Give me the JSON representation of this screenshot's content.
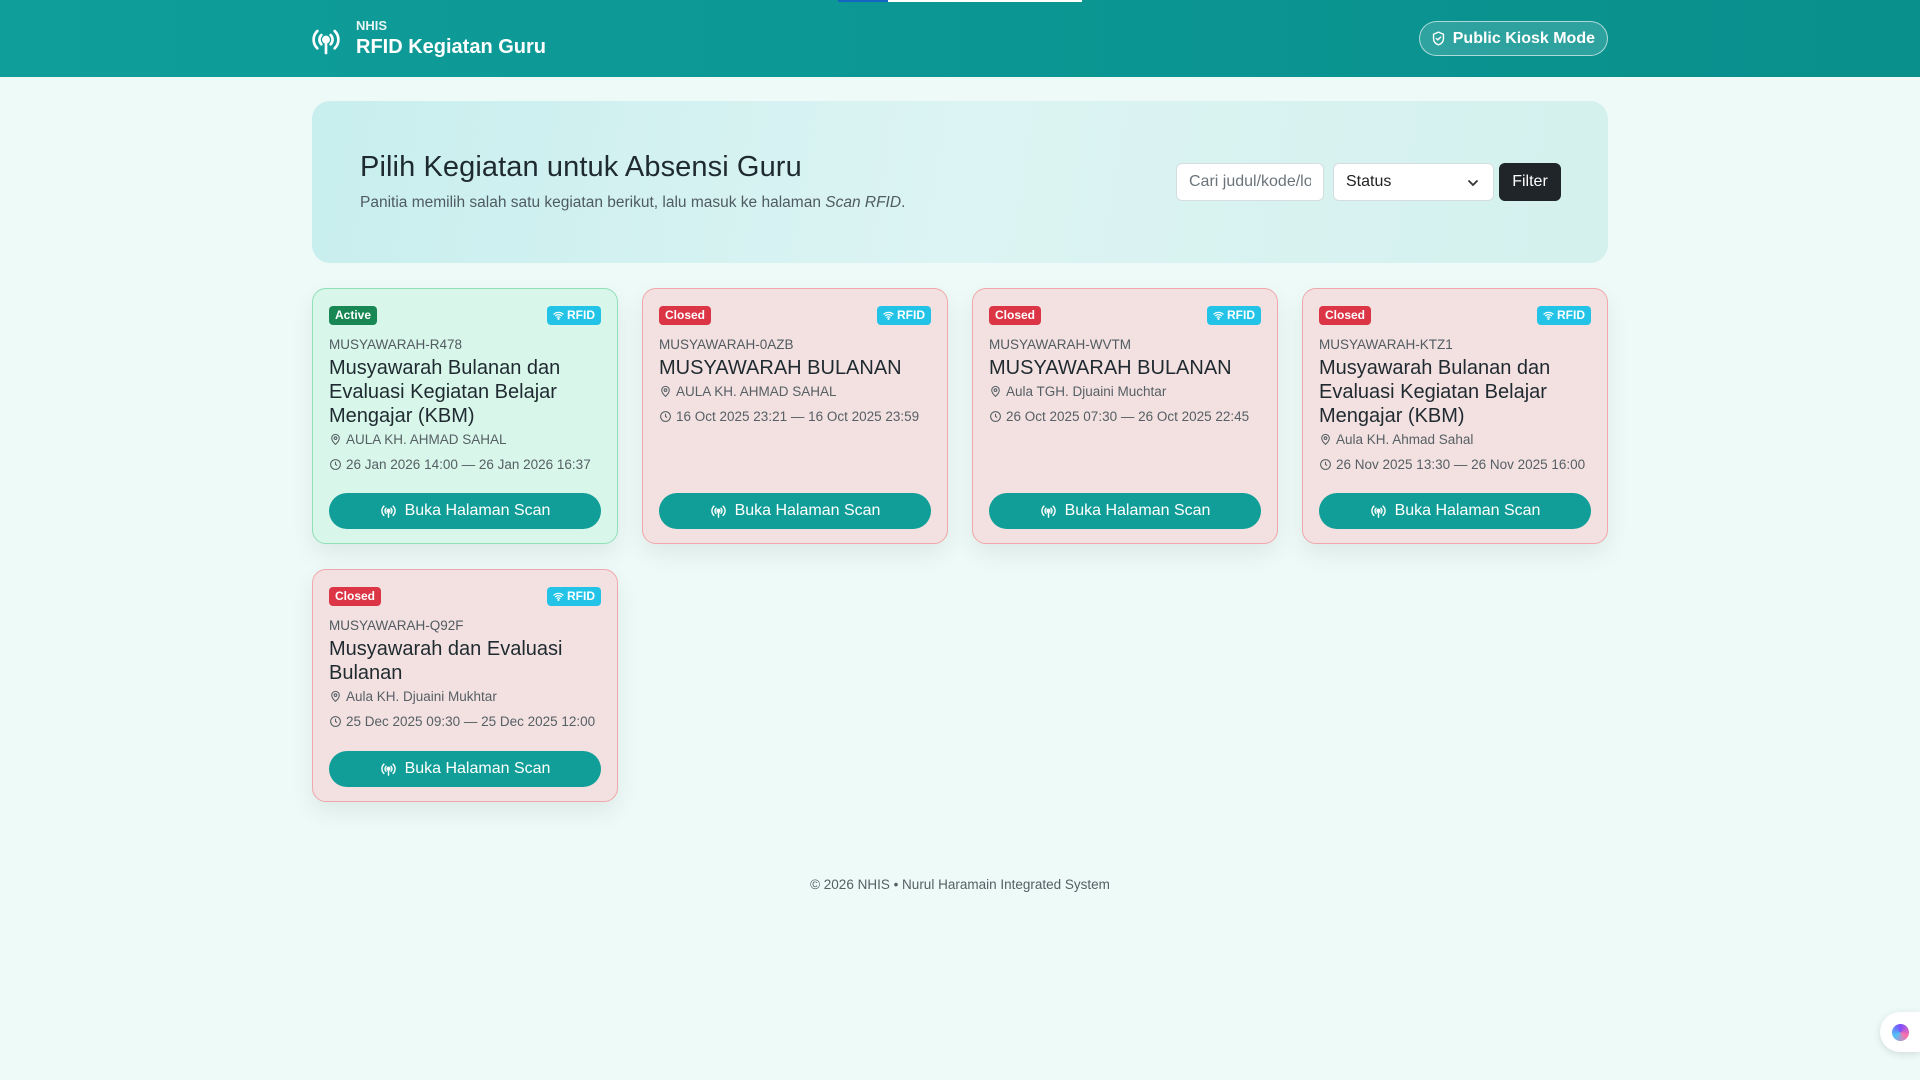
{
  "nav": {
    "brand_small": "NHIS",
    "brand_title": "RFID Kegiatan Guru",
    "kiosk_label": "Public Kiosk Mode"
  },
  "hero": {
    "title": "Pilih Kegiatan untuk Absensi Guru",
    "subtitle_prefix": "Panitia memilih salah satu kegiatan berikut, lalu masuk ke halaman ",
    "subtitle_em": "Scan RFID",
    "subtitle_suffix": ".",
    "search_placeholder": "Cari judul/kode/lokasi",
    "status_label": "Status",
    "filter_label": "Filter"
  },
  "rfid_label": "RFID",
  "scan_label": "Buka Halaman Scan",
  "events": [
    {
      "status": "Active",
      "code": "MUSYAWARAH-R478",
      "title": "Musyawarah Bulanan dan Evaluasi Kegiatan Belajar Mengajar (KBM)",
      "location": "AULA KH. AHMAD SAHAL",
      "time": "26 Jan 2026 14:00 — 26 Jan 2026 16:37"
    },
    {
      "status": "Closed",
      "code": "MUSYAWARAH-0AZB",
      "title": "MUSYAWARAH BULANAN",
      "location": "AULA KH. AHMAD SAHAL",
      "time": "16 Oct 2025 23:21 — 16 Oct 2025 23:59"
    },
    {
      "status": "Closed",
      "code": "MUSYAWARAH-WVTM",
      "title": "MUSYAWARAH BULANAN",
      "location": "Aula TGH. Djuaini Muchtar",
      "time": "26 Oct 2025 07:30 — 26 Oct 2025 22:45"
    },
    {
      "status": "Closed",
      "code": "MUSYAWARAH-KTZ1",
      "title": "Musyawarah Bulanan dan Evaluasi Kegiatan Belajar Mengajar (KBM)",
      "location": "Aula KH. Ahmad Sahal",
      "time": "26 Nov 2025 13:30 — 26 Nov 2025 16:00"
    },
    {
      "status": "Closed",
      "code": "MUSYAWARAH-Q92F",
      "title": "Musyawarah dan Evaluasi Bulanan",
      "location": "Aula KH. Djuaini Mukhtar",
      "time": "25 Dec 2025 09:30 — 25 Dec 2025 12:00"
    }
  ],
  "footer": "© 2026 NHIS • Nurul Haramain Integrated System",
  "colors": {
    "primary": "#119e98",
    "active": "#198754",
    "closed": "#dc3545",
    "rfid": "#22c3e6"
  }
}
